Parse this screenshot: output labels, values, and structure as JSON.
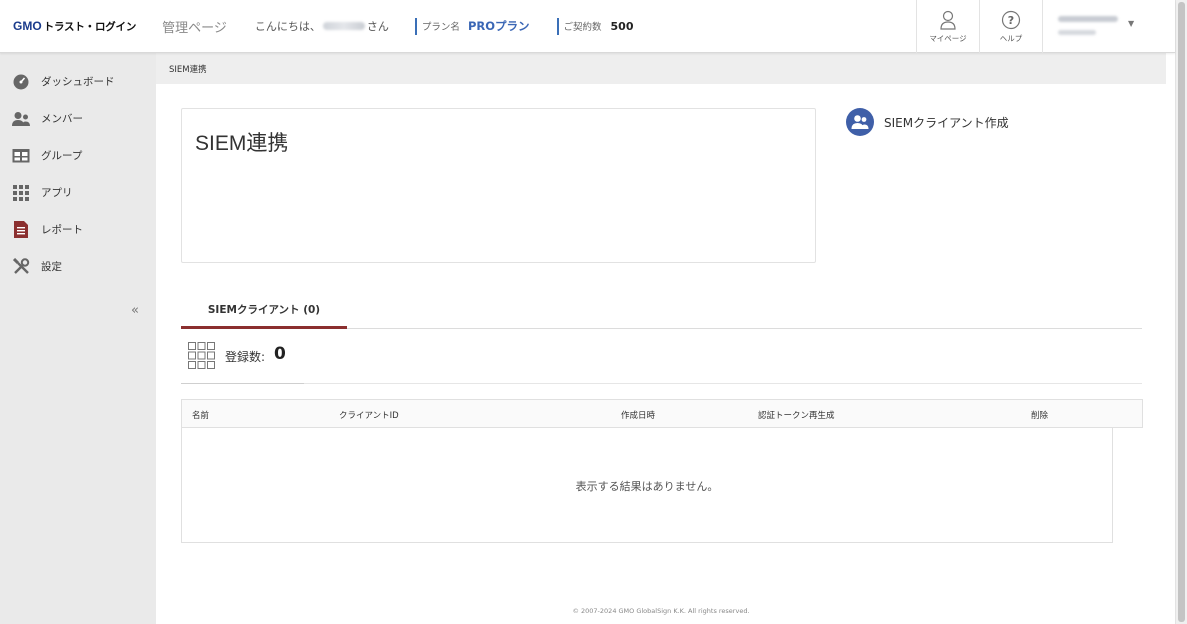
{
  "header": {
    "logo_gmo": "GMO",
    "logo_rest": "トラスト・ログイン",
    "admin_title": "管理ページ",
    "greeting_prefix": "こんにちは、",
    "greeting_suffix": "さん",
    "plan_label": "プラン名",
    "plan_value": "PROプラン",
    "contract_label": "ご契約数",
    "contract_value": "500",
    "mypage_label": "マイページ",
    "help_label": "ヘルプ",
    "user_caret": "▼"
  },
  "sidebar": {
    "items": [
      {
        "label": "ダッシュボード",
        "icon": "dashboard-icon"
      },
      {
        "label": "メンバー",
        "icon": "members-icon"
      },
      {
        "label": "グループ",
        "icon": "group-icon"
      },
      {
        "label": "アプリ",
        "icon": "apps-icon"
      },
      {
        "label": "レポート",
        "icon": "report-icon"
      },
      {
        "label": "設定",
        "icon": "settings-icon"
      }
    ],
    "collapse": "«"
  },
  "breadcrumb": "SIEM連携",
  "page": {
    "title": "SIEM連携",
    "create_button": "SIEMクライアント作成",
    "tab_label": "SIEMクライアント (0)",
    "count_label": "登録数:",
    "count_value": "0"
  },
  "table": {
    "columns": [
      "名前",
      "クライアントID",
      "作成日時",
      "認証トークン再生成",
      "削除"
    ],
    "empty_message": "表示する結果はありません。"
  },
  "footer": "© 2007-2024 GMO GlobalSign K.K. All rights reserved.",
  "colors": {
    "accent_blue": "#3a66b5",
    "tab_underline": "#8b2f2f",
    "create_icon_bg": "#3f5fa8"
  }
}
